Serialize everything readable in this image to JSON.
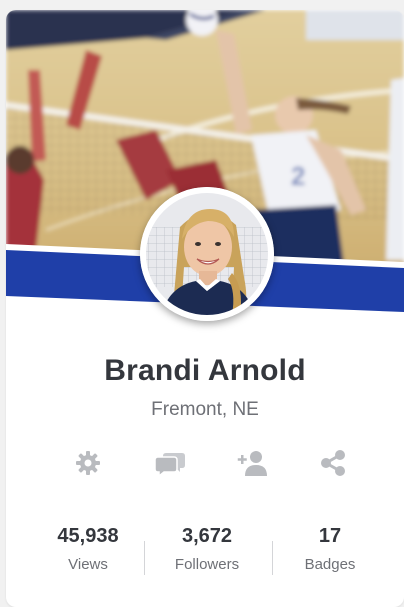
{
  "profile": {
    "name": "Brandi Arnold",
    "location": "Fremont, NE"
  },
  "actions": [
    {
      "icon": "gear-icon"
    },
    {
      "icon": "chat-bubbles-icon"
    },
    {
      "icon": "add-user-icon"
    },
    {
      "icon": "share-icon"
    }
  ],
  "stats": [
    {
      "value": "45,938",
      "label": "Views"
    },
    {
      "value": "3,672",
      "label": "Followers"
    },
    {
      "value": "17",
      "label": "Badges"
    }
  ],
  "colors": {
    "accent": "#1f3fa8",
    "name_text": "#34373d",
    "secondary_text": "#6e7076",
    "icon": "#b9bbbf"
  }
}
